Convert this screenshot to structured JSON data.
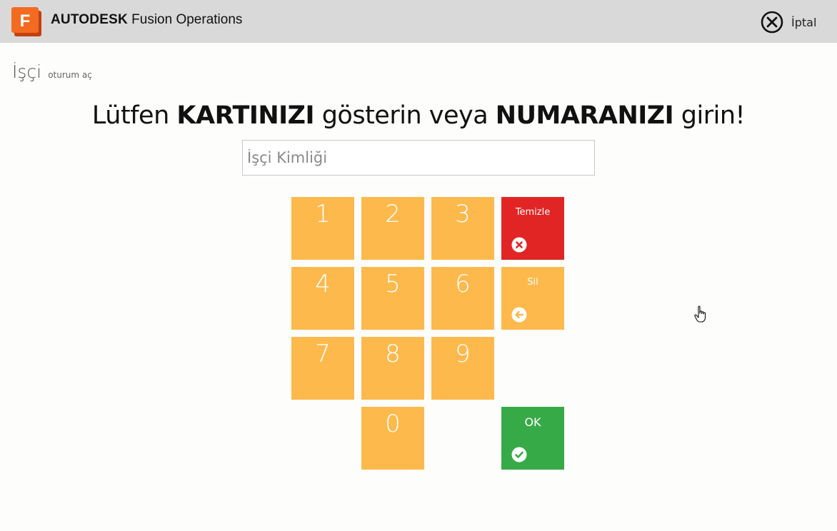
{
  "app": {
    "logo_letter": "F",
    "brand_bold": "AUTODESK",
    "brand_name": "Fusion Operations"
  },
  "header": {
    "cancel_label": "İptal",
    "cancel_icon": "close-circle-icon"
  },
  "page": {
    "title": "İşçi",
    "subtitle": "oturum aç"
  },
  "prompt": {
    "part1": "Lütfen ",
    "bold1": "KARTINIZI",
    "part2": " gösterin veya ",
    "bold2": "NUMARANIZI",
    "part3": " girin!"
  },
  "input": {
    "placeholder": "İşçi Kimliği",
    "value": ""
  },
  "keypad": {
    "digits": [
      "1",
      "2",
      "3",
      "4",
      "5",
      "6",
      "7",
      "8",
      "9",
      "0"
    ],
    "clear_label": "Temizle",
    "delete_label": "Sil",
    "ok_label": "OK"
  },
  "colors": {
    "key": "#fdb94c",
    "clear": "#e12525",
    "ok": "#37aa48",
    "header": "#d9d9d9",
    "logo": "#f26b21"
  }
}
